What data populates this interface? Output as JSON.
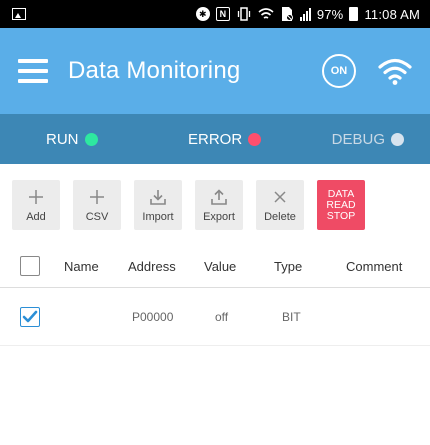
{
  "status_bar": {
    "battery": "97%",
    "time": "11:08 AM",
    "icons": [
      "image-icon",
      "bluetooth-icon",
      "nfc-icon",
      "vibrate-icon",
      "wifi-icon",
      "no-sim-icon",
      "signal-icon",
      "battery-icon"
    ]
  },
  "app_bar": {
    "title": "Data Monitoring",
    "on_badge": "ON",
    "colors": {
      "background": "#5aaee8"
    }
  },
  "indicators": {
    "run": {
      "label": "RUN",
      "color": "#2ee8a0"
    },
    "error": {
      "label": "ERROR",
      "color": "#ff4f6d"
    },
    "debug": {
      "label": "DEBUG",
      "color": "#d7e3ee"
    },
    "background": "#3d87b5"
  },
  "toolbar": {
    "add": {
      "label": "Add",
      "icon": "plus-icon"
    },
    "csv": {
      "label": "CSV",
      "icon": "plus-icon"
    },
    "import": {
      "label": "Import",
      "icon": "download-icon"
    },
    "export": {
      "label": "Export",
      "icon": "upload-icon"
    },
    "delete": {
      "label": "Delete",
      "icon": "close-icon"
    },
    "stop": {
      "line1": "DATA",
      "line2": "READ",
      "line3": "STOP",
      "color": "#ef4b65"
    }
  },
  "table": {
    "headers": {
      "name": "Name",
      "address": "Address",
      "value": "Value",
      "type": "Type",
      "comment": "Comment"
    },
    "rows": [
      {
        "checked": true,
        "name": "",
        "address": "P00000",
        "value": "off",
        "type": "BIT",
        "comment": ""
      }
    ]
  }
}
